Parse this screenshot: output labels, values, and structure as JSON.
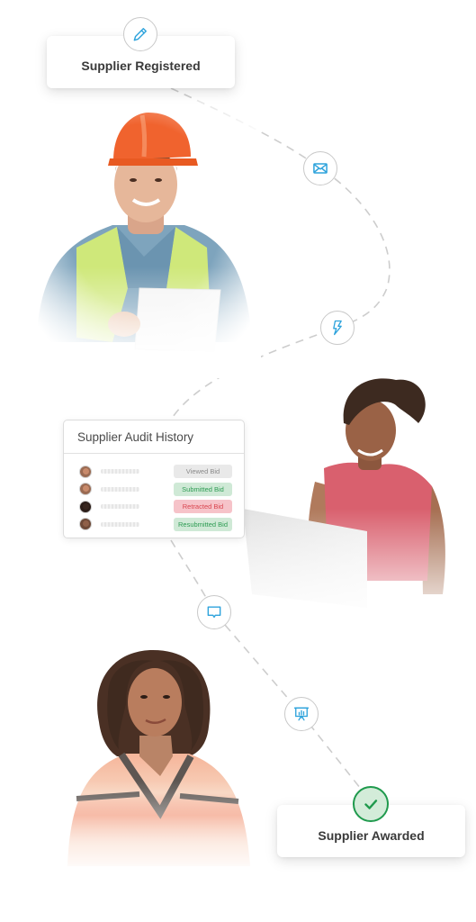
{
  "flow": {
    "start_step": {
      "label": "Supplier Registered",
      "icon": "pencil-icon"
    },
    "end_step": {
      "label": "Supplier Awarded",
      "icon": "check-circle-icon"
    },
    "connector_icons": [
      "mail-icon",
      "lightning-bolt-icon",
      "chat-bubble-icon",
      "presentation-chart-icon"
    ]
  },
  "audit_card": {
    "title": "Supplier Audit History",
    "rows": [
      {
        "avatar": "avatar-man-beard",
        "status": "Viewed Bid",
        "status_color": "#8a8a8a",
        "badge_bg": "#e9e9e9"
      },
      {
        "avatar": "avatar-man-beard",
        "status": "Submitted Bid",
        "status_color": "#2c9b52",
        "badge_bg": "#cfe9d6"
      },
      {
        "avatar": "avatar-woman-dark-hair",
        "status": "Retracted Bid",
        "status_color": "#d9454f",
        "badge_bg": "#f6c3c9"
      },
      {
        "avatar": "avatar-man-short-hair",
        "status": "Resubmitted Bid",
        "status_color": "#2c9b52",
        "badge_bg": "#cfe9d6"
      }
    ]
  },
  "people": [
    {
      "name": "construction-worker-with-tablet"
    },
    {
      "name": "woman-with-laptop"
    },
    {
      "name": "woman-portrait"
    }
  ],
  "colors": {
    "icon_accent": "#2ea3dc",
    "success": "#1f9a4d",
    "connector": "#c8c8c8"
  }
}
